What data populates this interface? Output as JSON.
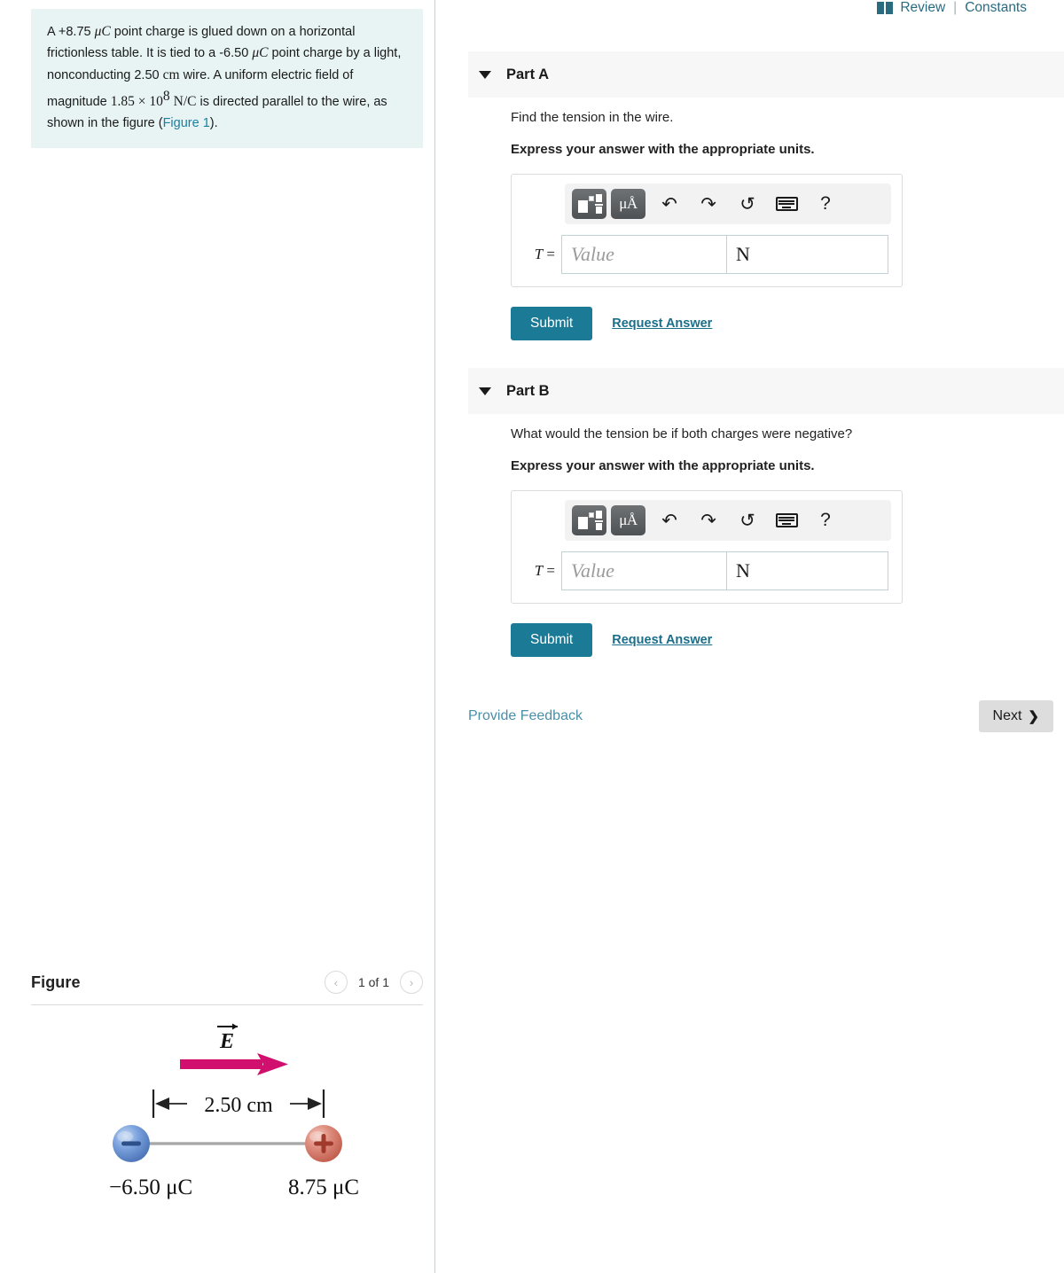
{
  "header": {
    "book_icon": "book-icon",
    "review_label": "Review",
    "separator": "|",
    "constants_label": "Constants"
  },
  "problem": {
    "text_parts": {
      "p1": "A +8.75 ",
      "muC1": "μC",
      "p2": " point charge is glued down on a horizontal frictionless table. It is tied to a -6.50 ",
      "muC2": "μC",
      "p3": " point charge by a light, nonconducting 2.50 ",
      "cm": "cm",
      "p4": " wire. A uniform electric field of magnitude ",
      "mag": "1.85 × 10",
      "exp": "8",
      "units": "N/C",
      "p5": " is directed parallel to the wire, as shown in the figure (",
      "link": "Figure 1",
      "p6": ")."
    }
  },
  "parts": [
    {
      "id": "part-a",
      "title": "Part A",
      "question": "Find the tension in the wire.",
      "instruction": "Express your answer with the appropriate units.",
      "toolbar": {
        "template_button": "math-template-icon",
        "units_button": "μÅ",
        "undo_icon": "↶",
        "redo_icon": "↷",
        "reset_icon": "↺",
        "keyboard_icon": "keyboard-icon",
        "help_icon": "?"
      },
      "answer": {
        "label_var": "T",
        "label_eq": "=",
        "value": "",
        "placeholder": "Value",
        "unit": "N"
      },
      "submit_label": "Submit",
      "request_answer_label": "Request Answer"
    },
    {
      "id": "part-b",
      "title": "Part B",
      "question": "What would the tension be if both charges were negative?",
      "instruction": "Express your answer with the appropriate units.",
      "toolbar": {
        "template_button": "math-template-icon",
        "units_button": "μÅ",
        "undo_icon": "↶",
        "redo_icon": "↷",
        "reset_icon": "↺",
        "keyboard_icon": "keyboard-icon",
        "help_icon": "?"
      },
      "answer": {
        "label_var": "T",
        "label_eq": "=",
        "value": "",
        "placeholder": "Value",
        "unit": "N"
      },
      "submit_label": "Submit",
      "request_answer_label": "Request Answer"
    }
  ],
  "footer": {
    "feedback_label": "Provide Feedback",
    "next_label": "Next",
    "next_chevron": "❯"
  },
  "figure": {
    "title": "Figure",
    "prev_icon": "‹",
    "next_icon": "›",
    "counter": "1 of 1",
    "diagram": {
      "field_label": "E",
      "field_arrow_color": "#d10f6e",
      "distance_label": "2.50 cm",
      "left_charge_label": "−6.50 μC",
      "left_charge_sign": "−",
      "left_charge_color": "#6b94d6",
      "right_charge_label": "8.75 μC",
      "right_charge_sign": "+",
      "right_charge_color": "#d9786a",
      "wire_color": "#b0b0b0"
    }
  },
  "colors": {
    "accent_teal": "#1b7a96",
    "problem_bg": "#e8f4f4",
    "part_header_bg": "#f7f7f7",
    "link_blue": "#4a8fa8"
  }
}
